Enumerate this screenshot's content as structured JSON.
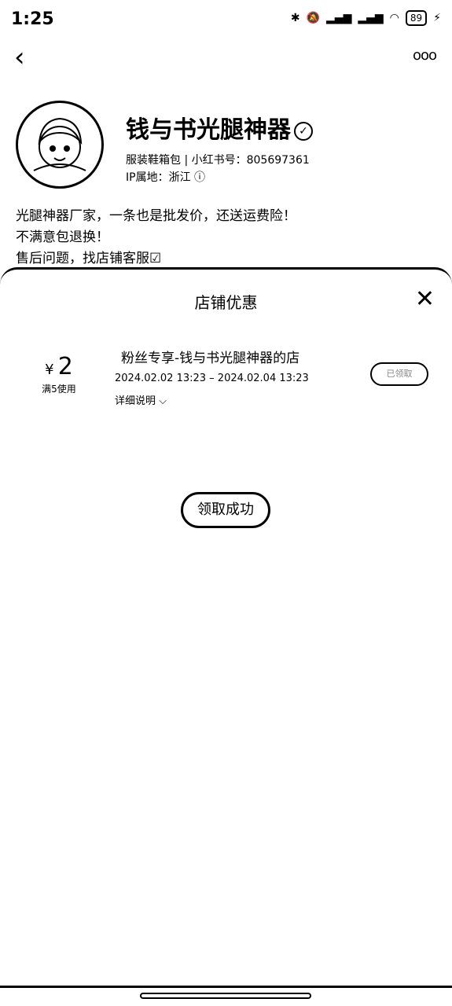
{
  "status_bar": {
    "time": "1:25",
    "battery": "89"
  },
  "profile": {
    "shop_name": "钱与书光腿神器",
    "meta_line1": "服装鞋箱包 | 小红书号：805697361",
    "meta_line2": "IP属地：浙江",
    "bio": [
      "光腿神器厂家，一条也是批发价，还送运费险！",
      "不满意包退换！",
      "售后问题，找店铺客服☑"
    ]
  },
  "sheet": {
    "title": "店铺优惠",
    "coupon": {
      "currency": "¥",
      "amount": "2",
      "condition": "满5使用",
      "title": "粉丝专享-钱与书光腿神器的店",
      "validity": "2024.02.02 13:23 – 2024.02.04 13:23",
      "detail_label": "详细说明",
      "claim_label": "已领取"
    },
    "toast": "领取成功"
  }
}
